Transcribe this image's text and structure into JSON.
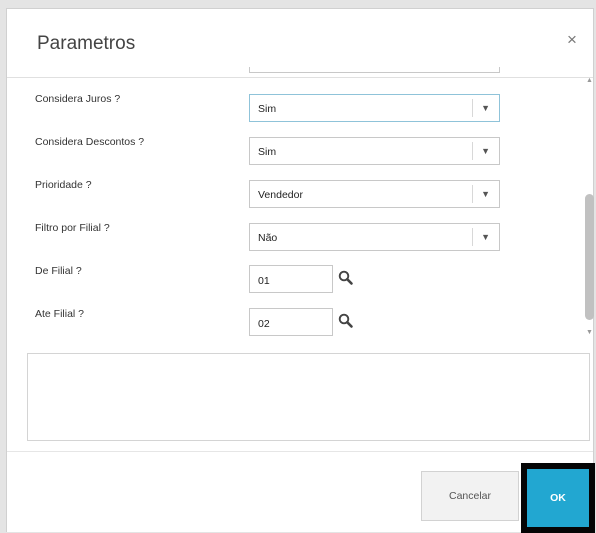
{
  "dialog": {
    "title": "Parametros",
    "close_symbol": "×"
  },
  "params": [
    {
      "label": "Considera Juros ?",
      "type": "select",
      "value": "Sim"
    },
    {
      "label": "Considera Descontos ?",
      "type": "select",
      "value": "Sim"
    },
    {
      "label": "Prioridade ?",
      "type": "select",
      "value": "Vendedor"
    },
    {
      "label": "Filtro por Filial ?",
      "type": "select",
      "value": "Não"
    },
    {
      "label": "De Filial ?",
      "type": "lookup",
      "value": "01"
    },
    {
      "label": "Ate Filial ?",
      "type": "lookup",
      "value": "02"
    }
  ],
  "icons": {
    "dropdown": "chevron-down-icon",
    "lookup": "search-icon",
    "scroll_up": "scroll-up-arrow-icon",
    "scroll_down": "scroll-down-arrow-icon"
  },
  "buttons": {
    "cancel_label": "Cancelar",
    "ok_label": "OK"
  },
  "colors": {
    "ok_button": "#22a7d1",
    "focus_border": "#8fc3d9",
    "highlight_frame": "#050505"
  }
}
